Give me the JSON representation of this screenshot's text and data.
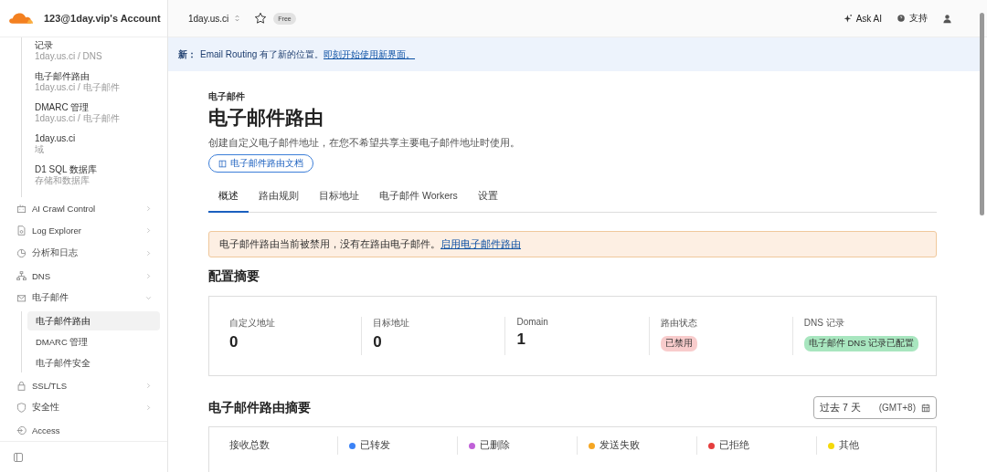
{
  "account": {
    "name": "123@1day.vip's Account"
  },
  "sidebar": {
    "recent": [
      {
        "title": "记录",
        "path": "1day.us.ci / DNS"
      },
      {
        "title": "电子邮件路由",
        "path": "1day.us.ci / 电子邮件"
      },
      {
        "title": "DMARC 管理",
        "path": "1day.us.ci / 电子邮件"
      },
      {
        "title": "1day.us.ci",
        "path": "域"
      },
      {
        "title": "D1 SQL 数据库",
        "path": "存储和数据库"
      }
    ],
    "items": [
      {
        "label": "AI Crawl Control",
        "kind": "group",
        "expanded": false
      },
      {
        "label": "Log Explorer",
        "kind": "group",
        "expanded": false
      },
      {
        "label": "分析和日志",
        "kind": "group",
        "expanded": false
      },
      {
        "label": "DNS",
        "kind": "group",
        "expanded": false
      },
      {
        "label": "电子邮件",
        "kind": "group",
        "expanded": true,
        "children": [
          {
            "label": "电子邮件路由",
            "selected": true
          },
          {
            "label": "DMARC 管理",
            "selected": false
          },
          {
            "label": "电子邮件安全",
            "selected": false
          }
        ]
      },
      {
        "label": "SSL/TLS",
        "kind": "group",
        "expanded": false
      },
      {
        "label": "安全性",
        "kind": "group",
        "expanded": false
      },
      {
        "label": "Access",
        "kind": "link"
      }
    ]
  },
  "topbar": {
    "domain": "1day.us.ci",
    "starred": false,
    "plan": "Free",
    "actions": [
      {
        "label": "Ask AI"
      },
      {
        "label": "支持"
      }
    ]
  },
  "banner": {
    "label": "新：",
    "text": "Email Routing 有了新的位置。",
    "link": "即刻开始使用新界面。"
  },
  "page": {
    "breadcrumb": "电子邮件",
    "title": "电子邮件路由",
    "description": "创建自定义电子邮件地址，在您不希望共享主要电子邮件地址时使用。",
    "docs_link": "电子邮件路由文档",
    "tabs": [
      {
        "label": "概述",
        "selected": true
      },
      {
        "label": "路由规则",
        "selected": false
      },
      {
        "label": "目标地址",
        "selected": false
      },
      {
        "label": "电子邮件 Workers",
        "selected": false
      },
      {
        "label": "设置",
        "selected": false
      }
    ],
    "alert": {
      "text": "电子邮件路由当前被禁用，没有在路由电子邮件。",
      "link": "启用电子邮件路由"
    },
    "config_summary": {
      "title": "配置摘要",
      "stats": [
        {
          "label": "自定义地址",
          "kind": "number",
          "value": "0"
        },
        {
          "label": "目标地址",
          "kind": "number",
          "value": "0"
        },
        {
          "label": "Domain",
          "kind": "number",
          "value": "1"
        },
        {
          "label": "路由状态",
          "kind": "badge",
          "value": "已禁用",
          "color": "#f8cccc"
        },
        {
          "label": "DNS 记录",
          "kind": "badge",
          "value": "电子邮件 DNS 记录已配置",
          "color": "#a8e6bf"
        }
      ]
    },
    "routing_summary": {
      "title": "电子邮件路由摘要",
      "date_range": {
        "value": "过去 7 天",
        "timezone": "(GMT+8)"
      },
      "metrics": [
        {
          "label": "接收总数"
        },
        {
          "label": "已转发",
          "color": "#3b82f6"
        },
        {
          "label": "已删除",
          "color": "#c061d8"
        },
        {
          "label": "发送失败",
          "color": "#f5a623"
        },
        {
          "label": "已拒绝",
          "color": "#e53e3e"
        },
        {
          "label": "其他",
          "color": "#f5d90a"
        }
      ]
    }
  }
}
